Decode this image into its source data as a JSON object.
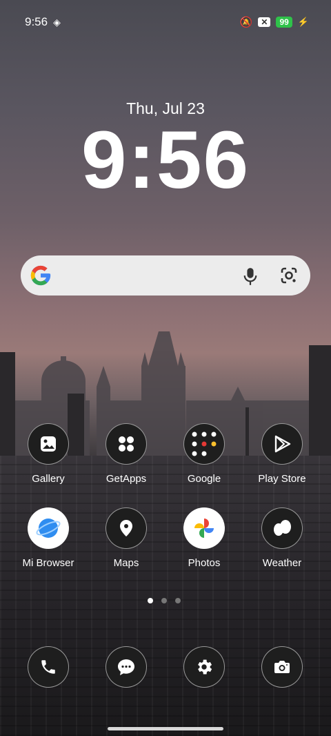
{
  "status": {
    "time": "9:56",
    "battery": "99"
  },
  "lockscreen": {
    "date": "Thu, Jul 23",
    "clock": "9:56"
  },
  "apps_row1": [
    {
      "label": "Gallery",
      "icon": "gallery-icon"
    },
    {
      "label": "GetApps",
      "icon": "getapps-icon"
    },
    {
      "label": "Google",
      "icon": "google-folder-icon"
    },
    {
      "label": "Play Store",
      "icon": "play-store-icon"
    }
  ],
  "apps_row2": [
    {
      "label": "Mi Browser",
      "icon": "mi-browser-icon"
    },
    {
      "label": "Maps",
      "icon": "maps-icon"
    },
    {
      "label": "Photos",
      "icon": "photos-icon"
    },
    {
      "label": "Weather",
      "icon": "weather-icon"
    }
  ],
  "dock": [
    {
      "icon": "phone-icon"
    },
    {
      "icon": "messages-icon"
    },
    {
      "icon": "settings-icon"
    },
    {
      "icon": "camera-icon"
    }
  ],
  "pager": {
    "pages": 3,
    "current": 1
  },
  "colors": {
    "battery": "#2fc24a",
    "search_bar": "#ececec"
  }
}
